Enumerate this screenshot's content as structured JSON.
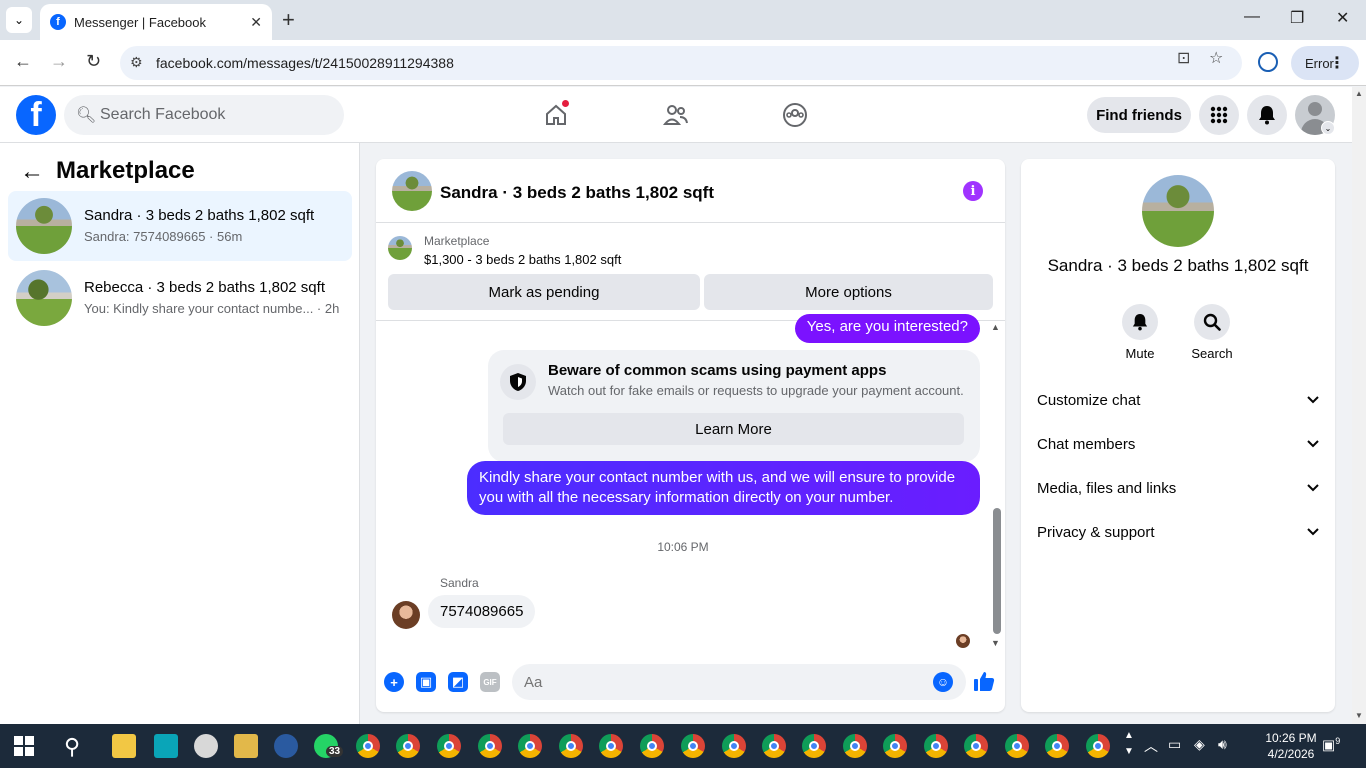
{
  "browser": {
    "tab_title": "Messenger | Facebook",
    "url": "facebook.com/messages/t/24150028911294388",
    "error_label": "Error"
  },
  "fb_header": {
    "search_placeholder": "Search Facebook",
    "find_friends": "Find friends"
  },
  "sidebar": {
    "title": "Marketplace",
    "conversations": [
      {
        "title": "Sandra · 3 beds 2 baths 1,802 sqft",
        "snippet": "Sandra: 7574089665 · 56m"
      },
      {
        "title": "Rebecca · 3 beds 2 baths 1,802 sqft",
        "snippet": "You: Kindly share your contact numbe... · 2h"
      }
    ]
  },
  "chat": {
    "title": "Sandra · 3 beds 2 baths 1,802 sqft",
    "marketplace_label": "Marketplace",
    "listing": "$1,300 - 3 beds 2 baths 1,802 sqft",
    "mark_pending": "Mark as pending",
    "more_options": "More options",
    "messages": {
      "out1": "Yes, are you interested?",
      "scam_title": "Beware of common scams using payment apps",
      "scam_body": "Watch out for fake emails or requests to upgrade your payment account.",
      "learn_more": "Learn More",
      "out2": "Kindly share your contact number with us, and we will ensure to provide you with all the necessary information directly on your number.",
      "timestamp": "10:06 PM",
      "sender": "Sandra",
      "in1": "7574089665"
    },
    "input_placeholder": "Aa"
  },
  "right_panel": {
    "name": "Sandra · 3 beds 2 baths 1,802 sqft",
    "mute": "Mute",
    "search": "Search",
    "sections": [
      "Customize chat",
      "Chat members",
      "Media, files and links",
      "Privacy & support"
    ]
  },
  "taskbar": {
    "whatsapp_badge": "33",
    "time": "10:26 PM",
    "date": "4/2/2026",
    "notif_count": "9"
  },
  "colors": {
    "fb_blue": "#0866ff",
    "out_bubble": "#7b12ff",
    "info_purple": "#a033ff"
  }
}
